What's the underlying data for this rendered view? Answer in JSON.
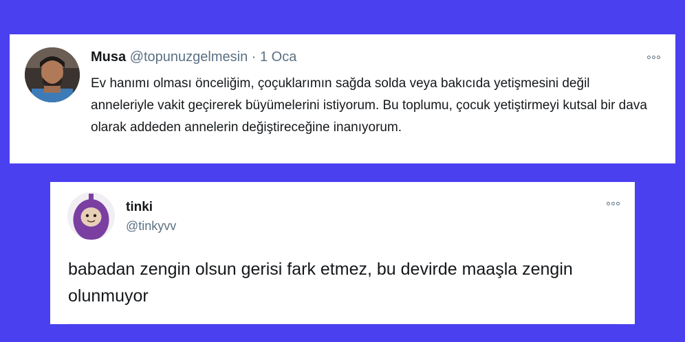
{
  "tweets": [
    {
      "name": "Musa",
      "handle": "@topunuzgelmesin",
      "separator": "·",
      "date": "1 Oca",
      "more_icon": "more-horizontal-icon",
      "text": "Ev hanımı olması önceliğim, çoçuklarımın sağda solda veya bakıcıda yetişmesini değil anneleriyle vakit geçirerek büyümelerini istiyorum. Bu toplumu, çocuk yetiştirmeyi kutsal bir dava olarak addeden annelerin değiştireceğine inanıyorum."
    },
    {
      "name": "tinki",
      "handle": "@tinkyvv",
      "more_icon": "more-horizontal-icon",
      "text": "babadan zengin olsun gerisi fark etmez, bu devirde maaşla zengin olunmuyor"
    }
  ],
  "colors": {
    "background": "#4a40f0",
    "card": "#ffffff",
    "text": "#14171a",
    "secondary": "#5b7083"
  }
}
